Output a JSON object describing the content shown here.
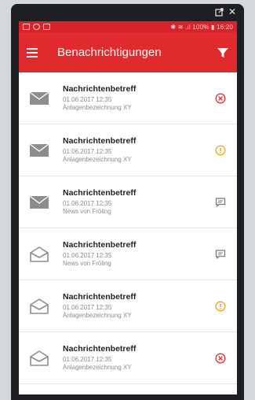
{
  "window": {
    "ctrl_icons": [
      "window-icon",
      "close-icon"
    ],
    "close_glyph": "✕"
  },
  "statusbar": {
    "right_text": "✱ ≋ .ıl 100% ▮ 16:20"
  },
  "appbar": {
    "title": "Benachrichtigungen",
    "bg": "#e02a2e"
  },
  "messages": [
    {
      "subject": "Nachrichtenbetreff",
      "date": "01.06.2017  12:35",
      "source": "Anlagenbezeichnung XY",
      "read": false,
      "status": "error"
    },
    {
      "subject": "Nachrichtenbetreff",
      "date": "01.06.2017  12:35",
      "source": "Anlagenbezeichnung XY",
      "read": false,
      "status": "warning"
    },
    {
      "subject": "Nachrichtenbetreff",
      "date": "01.06.2017  12:35",
      "source": "News von Fröling",
      "read": false,
      "status": "info"
    },
    {
      "subject": "Nachrichtenbetreff",
      "date": "01.06.2017  12:35",
      "source": "News von Fröling",
      "read": true,
      "status": "info"
    },
    {
      "subject": "Nachrichtenbetreff",
      "date": "01.06.2017  12:35",
      "source": "Anlagenbezeichnung XY",
      "read": true,
      "status": "warning"
    },
    {
      "subject": "Nachrichtenbetreff",
      "date": "01.06.2017  12:35",
      "source": "Anlagenbezeichnung XY",
      "read": true,
      "status": "error"
    }
  ],
  "colors": {
    "error": "#e53935",
    "warning": "#f5a623",
    "info": "#7a7a7a"
  }
}
